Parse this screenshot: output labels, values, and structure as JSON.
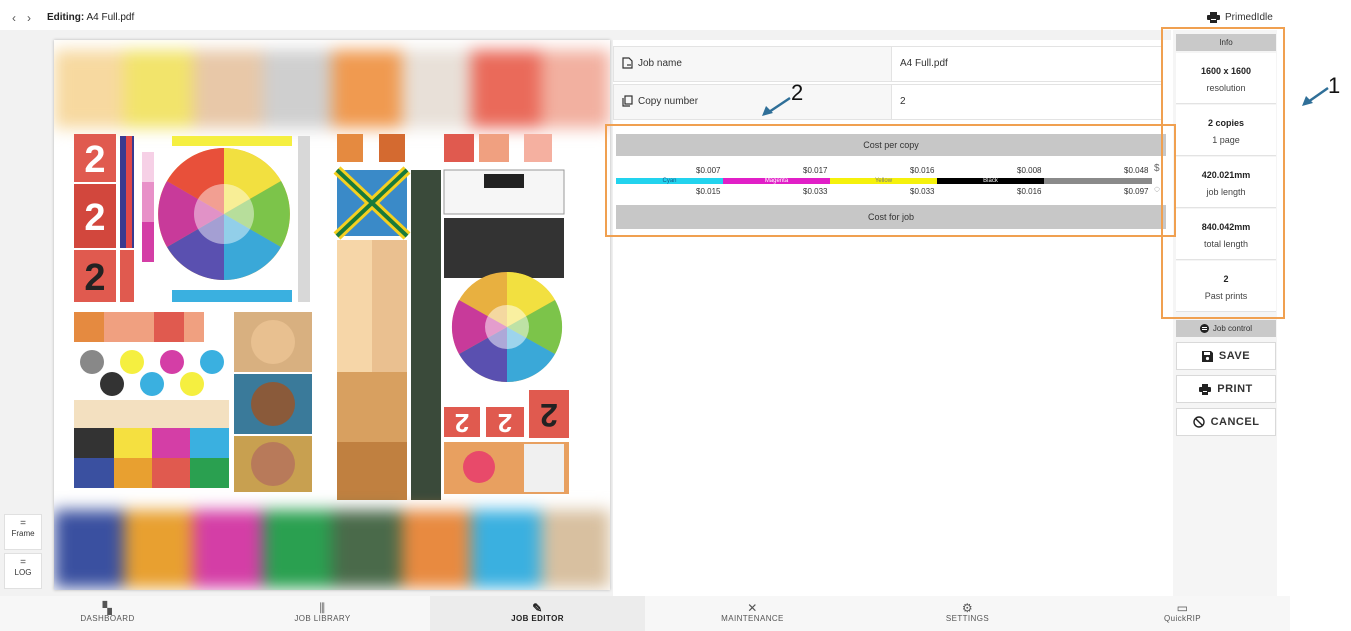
{
  "header": {
    "back_icon": "chevron-left-icon",
    "forward_icon": "chevron-right-icon",
    "title_prefix": "Editing:",
    "title_file": "A4 Full.pdf",
    "printer_name": "PrimedIdle"
  },
  "side_buttons": [
    {
      "label": "Frame"
    },
    {
      "label": "LOG"
    }
  ],
  "form": {
    "job_name_label": "Job name",
    "job_name_value": "A4 Full.pdf",
    "copy_number_label": "Copy number",
    "copy_number_value": "2"
  },
  "cost": {
    "per_copy_label": "Cost per copy",
    "per_job_label": "Cost for job",
    "channels": [
      {
        "name": "Cyan",
        "color": "#22d3ee",
        "per_copy": "$0.007",
        "per_job": "$0.015"
      },
      {
        "name": "Magenta",
        "color": "#e11fc7",
        "per_copy": "$0.017",
        "per_job": "$0.033"
      },
      {
        "name": "Yellow",
        "color": "#f5f10c",
        "per_copy": "$0.016",
        "per_job": "$0.033"
      },
      {
        "name": "Black",
        "color": "#000000",
        "per_copy": "$0.008",
        "per_job": "$0.016"
      }
    ],
    "total_per_copy": "$0.048",
    "total_per_job": "$0.097"
  },
  "info": {
    "header": "Info",
    "cards": [
      {
        "value": "1600 x 1600",
        "label": "resolution"
      },
      {
        "value": "2 copies",
        "label": "1 page"
      },
      {
        "value": "420.021mm",
        "label": "job length"
      },
      {
        "value": "840.042mm",
        "label": "total length"
      },
      {
        "value": "2",
        "label": "Past prints"
      }
    ]
  },
  "job_control": {
    "header": "Job control",
    "save_label": "SAVE",
    "print_label": "PRINT",
    "cancel_label": "CANCEL"
  },
  "annotations": {
    "one": "1",
    "two": "2",
    "accent": "#f0a050",
    "arrow_color": "#2f6f98"
  },
  "bottom_nav": [
    {
      "label": "DASHBOARD",
      "icon": "dashboard-icon"
    },
    {
      "label": "JOB LIBRARY",
      "icon": "library-icon"
    },
    {
      "label": "JOB EDITOR",
      "icon": "pencil-icon",
      "active": true
    },
    {
      "label": "MAINTENANCE",
      "icon": "tools-icon"
    },
    {
      "label": "SETTINGS",
      "icon": "gear-icon"
    },
    {
      "label": "QuickRIP",
      "icon": "quickrip-icon"
    }
  ]
}
